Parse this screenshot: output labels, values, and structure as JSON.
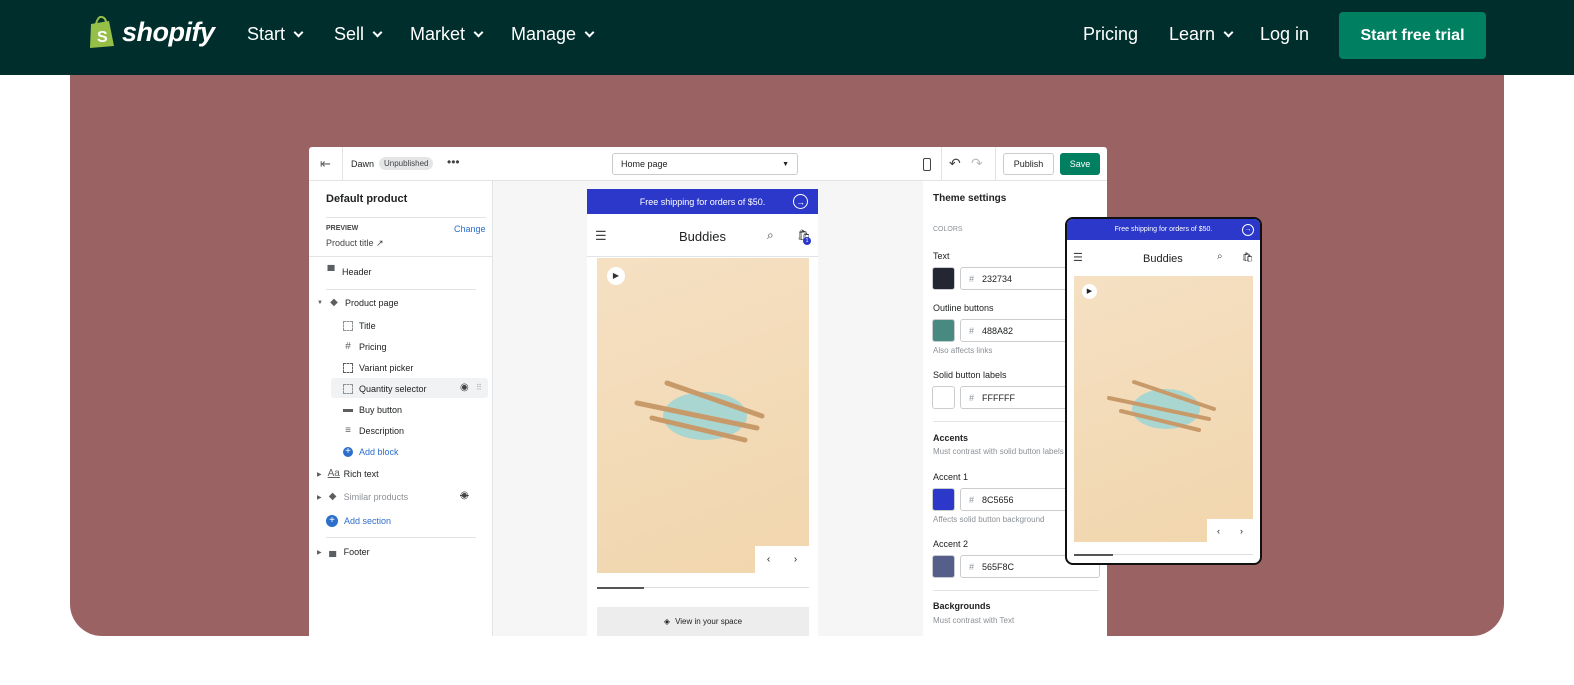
{
  "nav": {
    "logo": "shopify",
    "items": [
      {
        "label": "Start"
      },
      {
        "label": "Sell"
      },
      {
        "label": "Market"
      },
      {
        "label": "Manage"
      }
    ],
    "pricing": "Pricing",
    "learn": "Learn",
    "login": "Log in",
    "cta": "Start free trial"
  },
  "colors": {
    "nav_bg": "#002e2d",
    "cta": "#008060",
    "card": "#9b6263",
    "banner": "#2b38c9"
  },
  "editor": {
    "theme": "Dawn",
    "status": "Unpublished",
    "page_select": "Home page",
    "publish": "Publish",
    "save": "Save",
    "left": {
      "title": "Default product",
      "preview_label": "PREVIEW",
      "change": "Change",
      "preview_value": "Product title",
      "header": "Header",
      "product_page": "Product page",
      "blocks": [
        {
          "label": "Title",
          "icon": "dashed-square"
        },
        {
          "label": "Pricing",
          "icon": "#"
        },
        {
          "label": "Variant picker",
          "icon": "dashed-square"
        },
        {
          "label": "Quantity selector",
          "icon": "dashed-square"
        },
        {
          "label": "Buy button",
          "icon": "button"
        },
        {
          "label": "Description",
          "icon": "lines"
        }
      ],
      "add_block": "Add block",
      "rich_text": "Rich text",
      "similar_products": "Similar products",
      "add_section": "Add section",
      "footer": "Footer"
    },
    "preview": {
      "banner": "Free shipping for orders of $50.",
      "store": "Buddies",
      "cart_count": "1",
      "view_in_space": "View in your space"
    },
    "right": {
      "title": "Theme settings",
      "section": "COLORS",
      "text_label": "Text",
      "text_hex": "232734",
      "text_color": "#232734",
      "outline_label": "Outline buttons",
      "outline_hex": "488A82",
      "outline_color": "#488a82",
      "outline_note": "Also affects links",
      "solid_label": "Solid button labels",
      "solid_hex": "FFFFFF",
      "solid_color": "#ffffff",
      "accents": "Accents",
      "accents_note": "Must contrast with solid button labels",
      "accent1_label": "Accent 1",
      "accent1_hex": "8C5656",
      "accent1_color": "#2b38c9",
      "accent1_note": "Affects solid button background",
      "accent2_label": "Accent 2",
      "accent2_hex": "565F8C",
      "accent2_color": "#565f8c",
      "backgrounds": "Backgrounds",
      "backgrounds_note": "Must contrast with Text"
    }
  }
}
